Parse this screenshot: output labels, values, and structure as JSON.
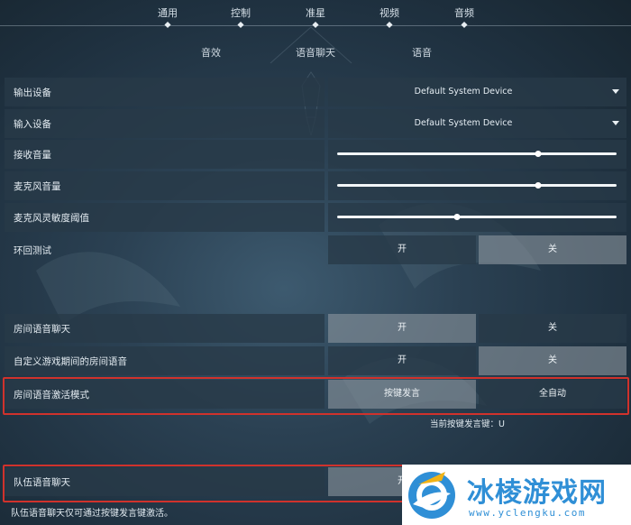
{
  "nav": {
    "tabs": [
      {
        "label": "通用"
      },
      {
        "label": "控制"
      },
      {
        "label": "准星"
      },
      {
        "label": "视频"
      },
      {
        "label": "音频",
        "active": true
      }
    ]
  },
  "subtabs": [
    {
      "label": "音效"
    },
    {
      "label": "语音聊天",
      "active": true
    },
    {
      "label": "语音"
    }
  ],
  "settings": {
    "output_device": {
      "label": "输出设备",
      "value": "Default System Device"
    },
    "input_device": {
      "label": "输入设备",
      "value": "Default System Device"
    },
    "receive_volume": {
      "label": "接收音量",
      "level": 0.72
    },
    "mic_volume": {
      "label": "麦克风音量",
      "level": 0.72
    },
    "mic_sensitivity": {
      "label": "麦克风灵敏度阈值",
      "level": 0.43
    },
    "loopback_test": {
      "label": "环回测试",
      "on": "开",
      "off": "关",
      "selected": "off"
    },
    "party_voice": {
      "label": "房间语音聊天",
      "on": "开",
      "off": "关",
      "selected": "on"
    },
    "custom_game_party_voice": {
      "label": "自定义游戏期间的房间语音",
      "on": "开",
      "off": "关",
      "selected": "off"
    },
    "party_voice_mode": {
      "label": "房间语音激活模式",
      "option_a": "按键发言",
      "option_b": "全自动",
      "selected": "a"
    },
    "current_ptt_key": "当前按键发言键：U",
    "team_voice": {
      "label": "队伍语音聊天",
      "on": "开"
    },
    "team_voice_note": "队伍语音聊天仅可通过按键发言键激活。"
  },
  "watermark": {
    "title": "冰棱游戏网",
    "url": "www.yclengku.com"
  },
  "colors": {
    "highlight": "#d0322c",
    "brand": "#2f8fd6"
  }
}
